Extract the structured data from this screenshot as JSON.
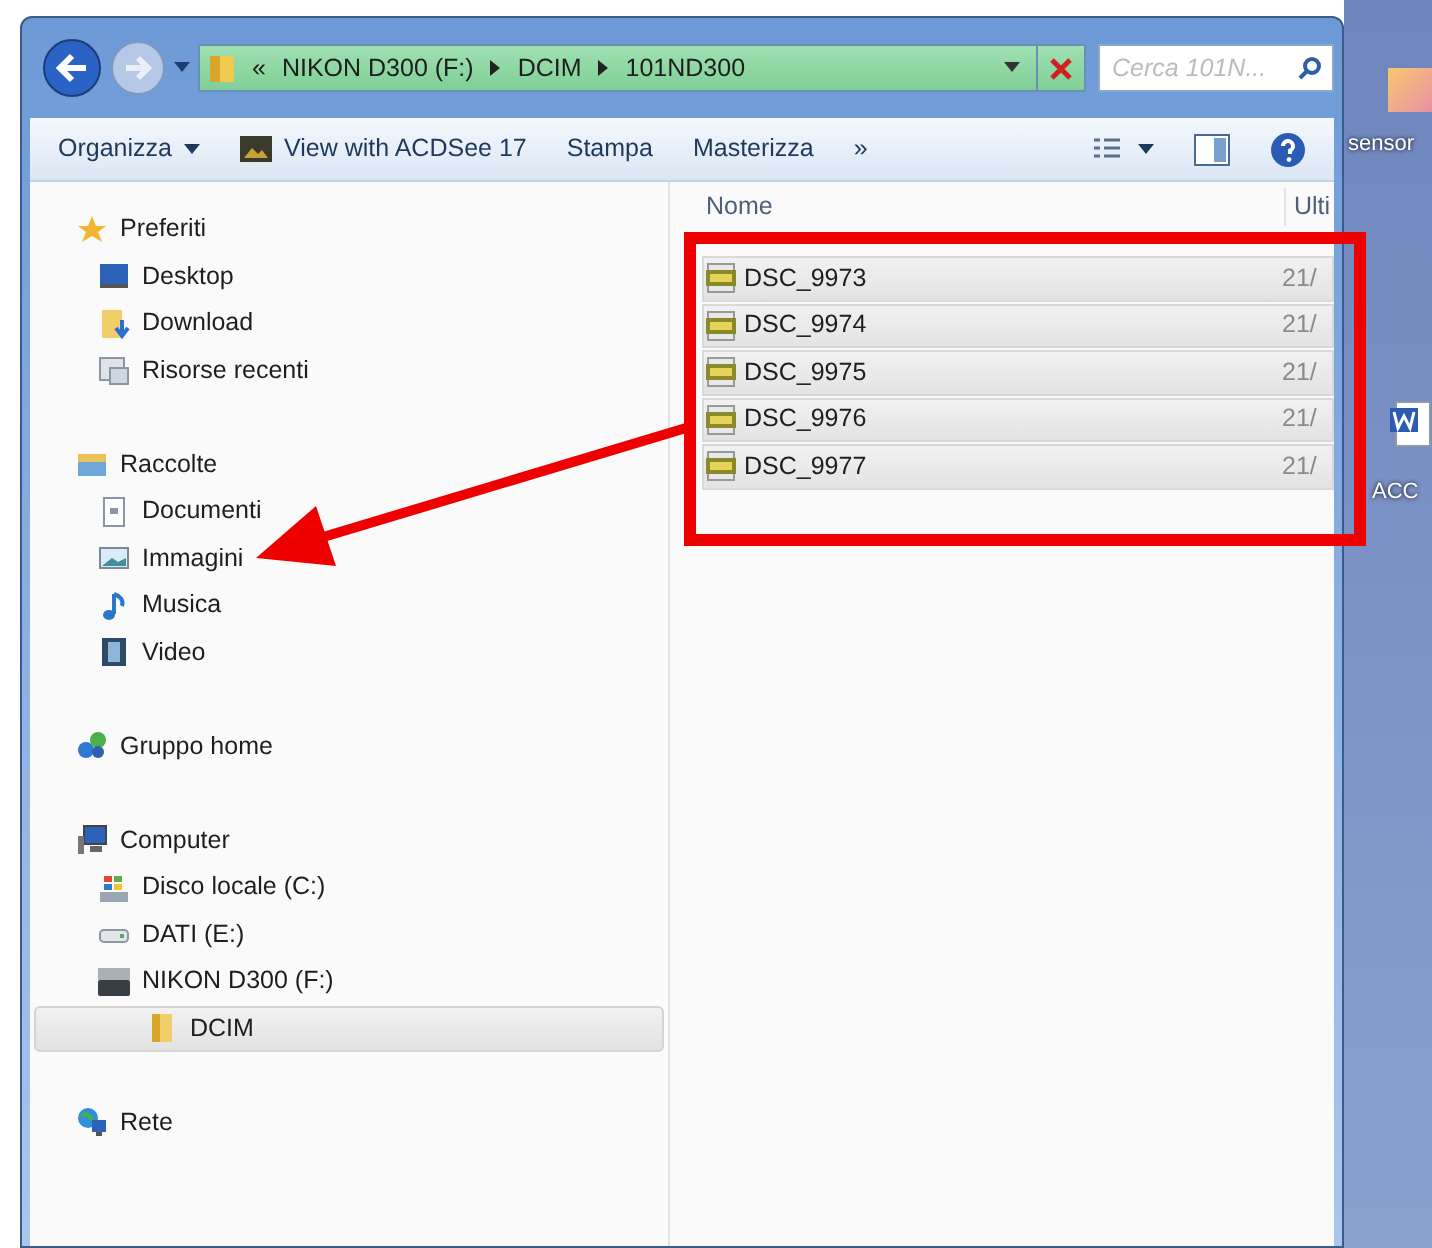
{
  "address_bar": {
    "overflow": "«",
    "crumbs": [
      "NIKON D300 (F:)",
      "DCIM",
      "101ND300"
    ]
  },
  "search": {
    "placeholder": "Cerca 101N..."
  },
  "toolbar": {
    "items": [
      {
        "label": "Organizza",
        "kind": "menu"
      },
      {
        "label": "View with ACDSee 17",
        "kind": "app"
      },
      {
        "label": "Stampa",
        "kind": "plain"
      },
      {
        "label": "Masterizza",
        "kind": "plain"
      },
      {
        "label": "»",
        "kind": "plain"
      }
    ]
  },
  "sidebar": {
    "groups": [
      {
        "label": "Preferiti",
        "children": [
          {
            "label": "Desktop",
            "selected": false
          },
          {
            "label": "Download",
            "selected": false
          },
          {
            "label": "Risorse recenti",
            "selected": false
          }
        ]
      },
      {
        "label": "Raccolte",
        "children": [
          {
            "label": "Documenti",
            "selected": false
          },
          {
            "label": "Immagini",
            "selected": false
          },
          {
            "label": "Musica",
            "selected": false
          },
          {
            "label": "Video",
            "selected": false
          }
        ]
      },
      {
        "label": "Gruppo home"
      },
      {
        "label": "Computer",
        "children": [
          {
            "label": "Disco locale (C:)",
            "selected": false
          },
          {
            "label": "DATI (E:)",
            "selected": false
          },
          {
            "label": "NIKON D300 (F:)",
            "selected": false,
            "children": [
              {
                "label": "DCIM",
                "selected": true
              }
            ]
          }
        ]
      },
      {
        "label": "Rete"
      }
    ]
  },
  "file_list": {
    "columns": [
      "Nome",
      "Ulti"
    ],
    "rows": [
      {
        "name": "DSC_9973",
        "date": "21/",
        "selected": true
      },
      {
        "name": "DSC_9974",
        "date": "21/",
        "selected": true
      },
      {
        "name": "DSC_9975",
        "date": "21/",
        "selected": true
      },
      {
        "name": "DSC_9976",
        "date": "21/",
        "selected": true
      },
      {
        "name": "DSC_9977",
        "date": "21/",
        "selected": true
      }
    ]
  },
  "desktop": {
    "icons": [
      {
        "label": "sensor"
      },
      {
        "label": "ACC"
      }
    ]
  }
}
